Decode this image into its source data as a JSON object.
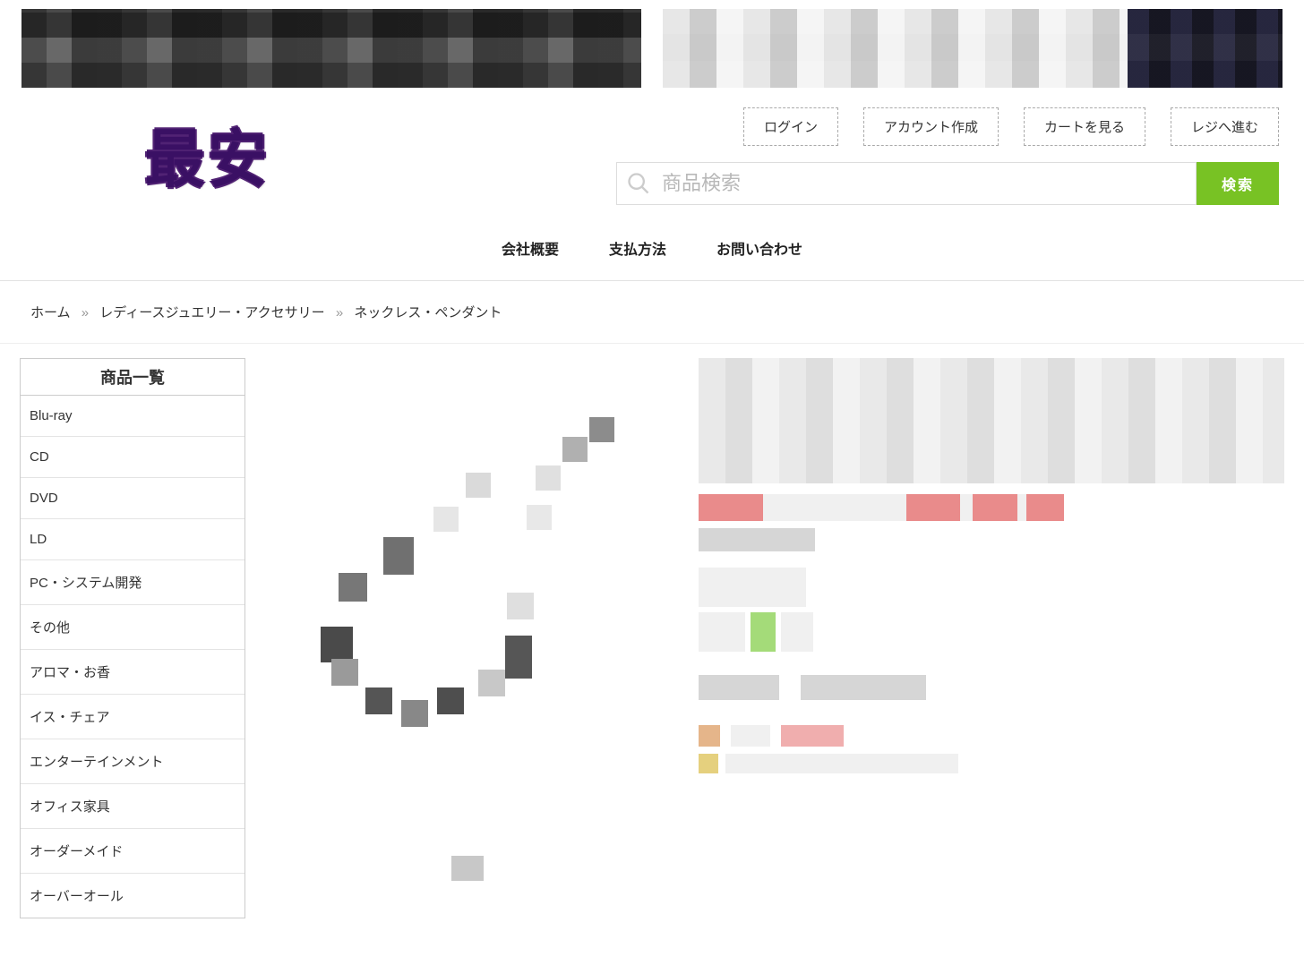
{
  "logo_text": "最安",
  "account_links": {
    "login": "ログイン",
    "create": "アカウント作成",
    "cart": "カートを見る",
    "checkout": "レジへ進む"
  },
  "search": {
    "placeholder": "商品検索",
    "button": "検索"
  },
  "nav": {
    "company": "会社概要",
    "payment": "支払方法",
    "contact": "お問い合わせ"
  },
  "breadcrumb": {
    "home": "ホーム",
    "cat1": "レディースジュエリー・アクセサリー",
    "cat2": "ネックレス・ペンダント",
    "sep": "»"
  },
  "sidebar": {
    "title": "商品一覧",
    "items": [
      "Blu-ray",
      "CD",
      "DVD",
      "LD",
      "PC・システム開発",
      "その他",
      "アロマ・お香",
      "イス・チェア",
      "エンターテインメント",
      "オフィス家具",
      "オーダーメイド",
      "オーバーオール"
    ]
  }
}
